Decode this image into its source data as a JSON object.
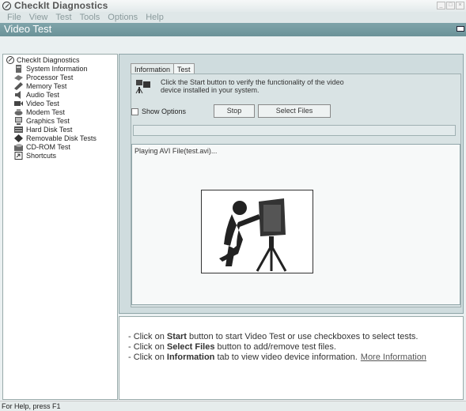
{
  "app": {
    "title": "CheckIt Diagnostics"
  },
  "menu": [
    "File",
    "View",
    "Test",
    "Tools",
    "Options",
    "Help"
  ],
  "view": {
    "title": "Video Test"
  },
  "tree": {
    "root": "CheckIt Diagnostics",
    "items": [
      {
        "label": "System Information",
        "icon": "system-info-icon"
      },
      {
        "label": "Processor Test",
        "icon": "processor-icon"
      },
      {
        "label": "Memory Test",
        "icon": "memory-icon"
      },
      {
        "label": "Audio Test",
        "icon": "audio-icon"
      },
      {
        "label": "Video Test",
        "icon": "video-icon"
      },
      {
        "label": "Modem Test",
        "icon": "modem-icon"
      },
      {
        "label": "Graphics Test",
        "icon": "graphics-icon"
      },
      {
        "label": "Hard Disk Test",
        "icon": "hard-disk-icon"
      },
      {
        "label": "Removable Disk Tests",
        "icon": "removable-disk-icon"
      },
      {
        "label": "CD-ROM Test",
        "icon": "cdrom-icon"
      },
      {
        "label": "Shortcuts",
        "icon": "shortcuts-icon"
      }
    ]
  },
  "tabs": [
    "Information",
    "Test"
  ],
  "test": {
    "description_line1": "Click the Start button to verify the functionality of the video",
    "description_line2": "device installed in your system.",
    "show_options": "Show Options",
    "stop_label": "Stop",
    "select_files_label": "Select Files",
    "playing": "Playing AVI File(test.avi)..."
  },
  "info": {
    "line1_pre": "- Click on ",
    "line1_bold": "Start",
    "line1_post": " button to start Video Test or use checkboxes to select tests.",
    "line2_pre": "- Click on ",
    "line2_bold": "Select Files",
    "line2_post": " button to add/remove test files.",
    "line3_pre": "- Click on ",
    "line3_bold": "Information",
    "line3_post": " tab to view video device information.",
    "more_link": "More Information"
  },
  "status": "For Help, press F1"
}
